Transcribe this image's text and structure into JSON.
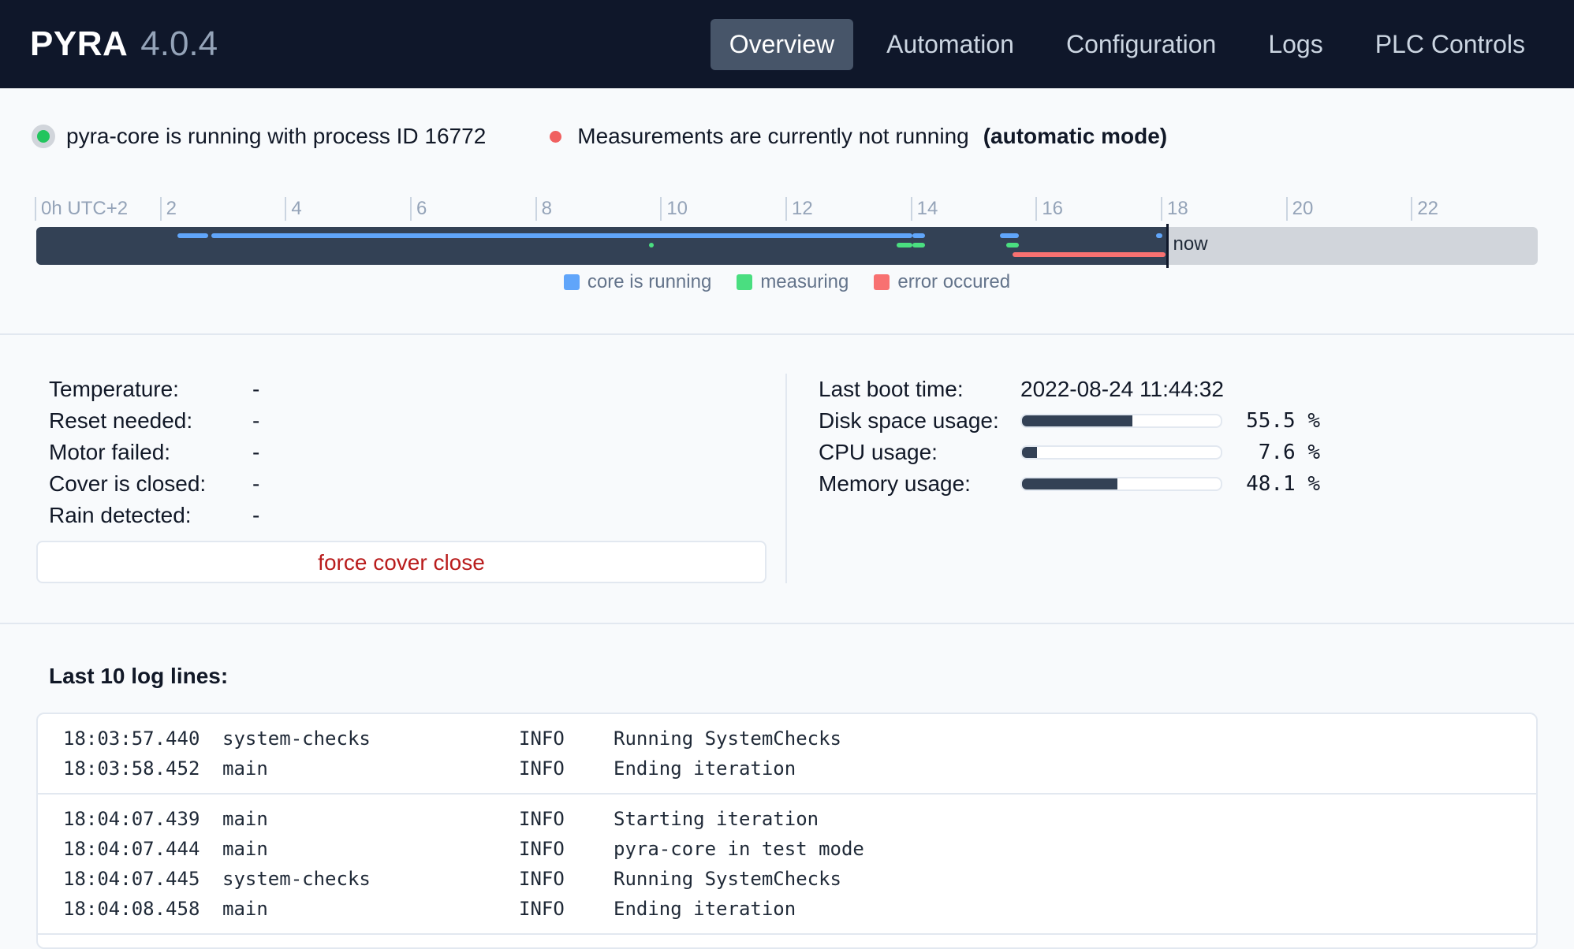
{
  "header": {
    "brand": "PYRA",
    "version": "4.0.4",
    "nav": [
      {
        "label": "Overview",
        "active": true
      },
      {
        "label": "Automation",
        "active": false
      },
      {
        "label": "Configuration",
        "active": false
      },
      {
        "label": "Logs",
        "active": false
      },
      {
        "label": "PLC Controls",
        "active": false
      }
    ]
  },
  "status": {
    "core_text": "pyra-core is running with process ID 16772",
    "measurement_text": "Measurements are currently not running",
    "mode_text": "(automatic mode)"
  },
  "timeline": {
    "ticks": [
      "0h UTC+2",
      "2",
      "4",
      "6",
      "8",
      "10",
      "12",
      "14",
      "16",
      "18",
      "20",
      "22"
    ],
    "now_label": "now",
    "now_hour": 18.07,
    "core_running": [
      [
        2.25,
        2.75
      ],
      [
        2.8,
        14.0
      ],
      [
        14.0,
        14.2
      ],
      [
        15.4,
        15.7
      ],
      [
        17.9,
        18.0
      ]
    ],
    "measuring": [
      [
        9.8,
        9.85
      ],
      [
        13.75,
        14.0
      ],
      [
        14.0,
        14.2
      ],
      [
        15.5,
        15.7
      ]
    ],
    "errors": [
      [
        15.6,
        18.05
      ]
    ],
    "legend": [
      {
        "label": "core is running",
        "color": "#60a5fa"
      },
      {
        "label": "measuring",
        "color": "#4ade80"
      },
      {
        "label": "error occured",
        "color": "#f87171"
      }
    ]
  },
  "plc_state": {
    "rows": [
      {
        "label": "Temperature:",
        "value": "-"
      },
      {
        "label": "Reset needed:",
        "value": "-"
      },
      {
        "label": "Motor failed:",
        "value": "-"
      },
      {
        "label": "Cover is closed:",
        "value": "-"
      },
      {
        "label": "Rain detected:",
        "value": "-"
      }
    ],
    "force_close_label": "force cover close"
  },
  "system_state": {
    "boot_label": "Last boot time:",
    "boot_value": "2022-08-24 11:44:32",
    "usages": [
      {
        "label": "Disk space usage:",
        "value": 55.5,
        "text": "55.5 %"
      },
      {
        "label": "CPU usage:",
        "value": 7.6,
        "text": "7.6 %"
      },
      {
        "label": "Memory usage:",
        "value": 48.1,
        "text": "48.1 %"
      }
    ]
  },
  "logs": {
    "title": "Last 10 log lines:",
    "groups": [
      [
        {
          "time": "18:03:57.440",
          "source": "system-checks",
          "level": "INFO",
          "message": "Running SystemChecks"
        },
        {
          "time": "18:03:58.452",
          "source": "main",
          "level": "INFO",
          "message": "Ending iteration"
        }
      ],
      [
        {
          "time": "18:04:07.439",
          "source": "main",
          "level": "INFO",
          "message": "Starting iteration"
        },
        {
          "time": "18:04:07.444",
          "source": "main",
          "level": "INFO",
          "message": "pyra-core in test mode"
        },
        {
          "time": "18:04:07.445",
          "source": "system-checks",
          "level": "INFO",
          "message": "Running SystemChecks"
        },
        {
          "time": "18:04:08.458",
          "source": "main",
          "level": "INFO",
          "message": "Ending iteration"
        }
      ]
    ]
  }
}
